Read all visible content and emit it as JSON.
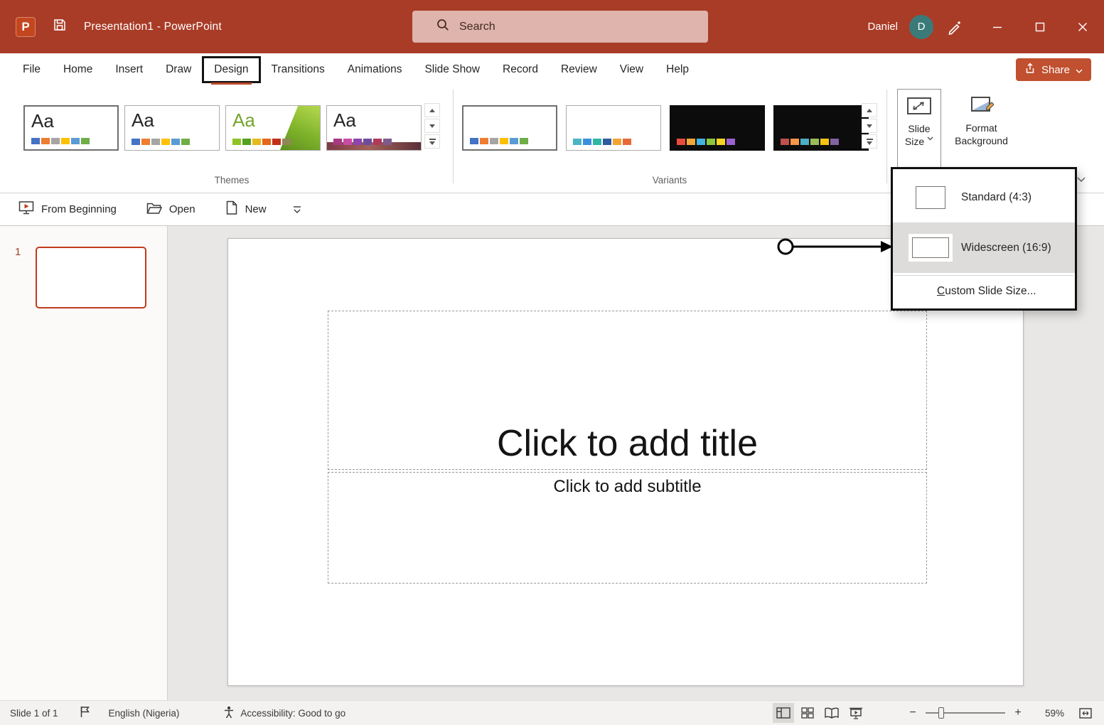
{
  "colors": {
    "titlebar_bg": "#A93C27",
    "accent_red": "#B7472A",
    "selection_border": "#C13B1C",
    "avatar_bg": "#3A7B7A",
    "share_button_bg": "#C0502F",
    "menu_highlight_bg": "#DEDCDA"
  },
  "title_bar": {
    "document_title": "Presentation1  -  PowerPoint",
    "search_placeholder": "Search",
    "user_name": "Daniel",
    "user_initial": "D"
  },
  "menu_bar": {
    "tabs": [
      "File",
      "Home",
      "Insert",
      "Draw",
      "Design",
      "Transitions",
      "Animations",
      "Slide Show",
      "Record",
      "Review",
      "View",
      "Help"
    ],
    "active_tab": "Design",
    "share_label": "Share"
  },
  "ribbon": {
    "theme_sample": "Aa",
    "themes_label": "Themes",
    "variants_label": "Variants",
    "slide_size": {
      "line1": "Slide",
      "line2": "Size"
    },
    "format_background": {
      "line1": "Format",
      "line2": "Background"
    },
    "theme_swatches": {
      "theme1": [
        "#4472C4",
        "#ED7D31",
        "#A5A5A5",
        "#FFC000",
        "#5B9BD5",
        "#70AD47"
      ],
      "theme2": [
        "#4472C4",
        "#ED7D31",
        "#A5A5A5",
        "#FFC000",
        "#5B9BD5",
        "#70AD47"
      ],
      "theme3": [
        "#90C226",
        "#54A021",
        "#E6B91E",
        "#E76618",
        "#C42F1A",
        "#918655"
      ],
      "theme4": [
        "#A73A84",
        "#C94BA6",
        "#8E44AD",
        "#6C4E9E",
        "#B03A5B",
        "#7D5C8C"
      ]
    },
    "variant_swatches": {
      "variant1": [
        "#4472C4",
        "#ED7D31",
        "#A5A5A5",
        "#FFC000",
        "#5B9BD5",
        "#70AD47"
      ],
      "variant2": [
        "#4AB5C4",
        "#3E8EDE",
        "#2FB6A4",
        "#2F5B9F",
        "#F2A431",
        "#E8683A"
      ],
      "variant3": [
        "#E84C3D",
        "#F1A83B",
        "#43B3E0",
        "#8DC63F",
        "#F5D327",
        "#9B62D0"
      ],
      "variant4": [
        "#C0504D",
        "#F79646",
        "#4BACC6",
        "#9BBB59",
        "#F2C314",
        "#8064A2"
      ]
    }
  },
  "slide_size_menu": {
    "standard": "Standard (4:3)",
    "widescreen": "Widescreen (16:9)",
    "custom_accelerator": "C",
    "custom_rest": "ustom Slide Size..."
  },
  "quick_actions": {
    "from_beginning": "From Beginning",
    "open": "Open",
    "new": "New"
  },
  "thumbnail_pane": {
    "slide_number": "1"
  },
  "slide": {
    "title_placeholder": "Click to add title",
    "subtitle_placeholder": "Click to add subtitle"
  },
  "status_bar": {
    "slide_counter": "Slide 1 of 1",
    "language": "English (Nigeria)",
    "accessibility_status": "Accessibility: Good to go",
    "zoom_level": "59%"
  }
}
